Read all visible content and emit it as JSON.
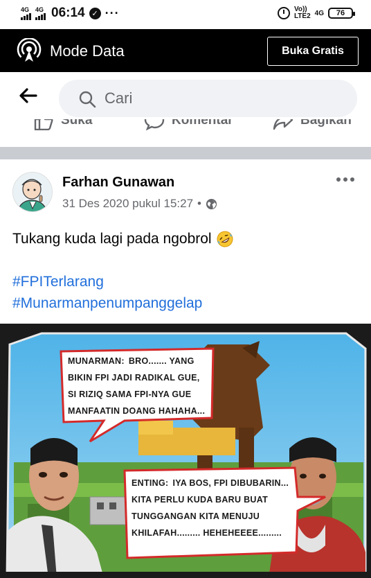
{
  "status_bar": {
    "sim1": "4G",
    "sim2": "4G",
    "time": "06:14",
    "more": "···",
    "volte_top": "Vo))",
    "volte_bottom": "LTE2",
    "net": "4G",
    "battery": "76"
  },
  "mode_bar": {
    "title": "Mode Data",
    "button_label": "Buka Gratis",
    "icon": "broadcast-icon"
  },
  "search": {
    "placeholder": "Cari"
  },
  "prev_post_actions": [
    {
      "label": "Suka",
      "icon": "like-icon"
    },
    {
      "label": "Komentar",
      "icon": "comment-icon"
    },
    {
      "label": "Bagikan",
      "icon": "share-icon"
    }
  ],
  "post": {
    "author": "Farhan Gunawan",
    "timestamp": "31 Des 2020 pukul 15:27",
    "separator": "•",
    "privacy_icon": "globe-icon",
    "text": "Tukang kuda lagi pada ngobrol",
    "emoji": "rolling-laughing-emoji",
    "hashtags": [
      "#FPITerlarang",
      "#Munarmanpenumpanggelap"
    ],
    "image": {
      "bubble1": {
        "speaker": "MUNARMAN:",
        "lines": [
          "BRO....... YANG",
          "BIKIN FPI JADI RADIKAL GUE,",
          "SI RIZIQ SAMA FPI-NYA GUE",
          "MANFAATIN DOANG HAHAHA..."
        ]
      },
      "bubble2": {
        "speaker": "ENTING:",
        "lines": [
          "IYA BOS, FPI DIBUBARIN...",
          "KITA PERLU KUDA BARU BUAT",
          "TUNGGANGAN KITA MENUJU",
          "KHILAFAH......... HEHEHEEEE........."
        ]
      }
    }
  },
  "colors": {
    "mode_bar_bg": "#000000",
    "hashtag": "#216fdb",
    "divider": "#c9ccd1",
    "meta_gray": "#65676b"
  }
}
